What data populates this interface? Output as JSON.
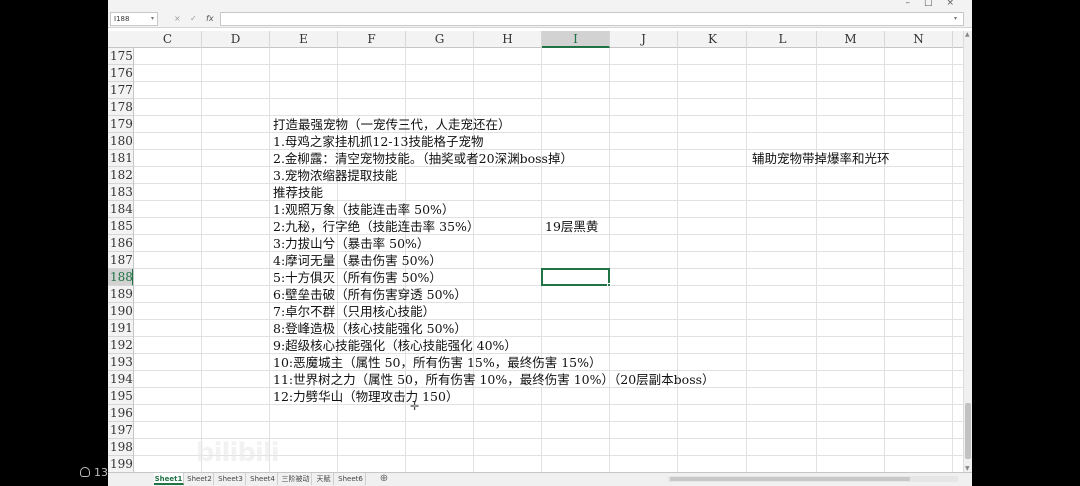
{
  "window": {
    "controls": [
      "–",
      "□",
      "×"
    ]
  },
  "formula_bar": {
    "name_box": "I188",
    "cancel_icon": "×",
    "enter_icon": "✓",
    "fx_label": "fx",
    "value": ""
  },
  "columns": [
    "C",
    "D",
    "E",
    "F",
    "G",
    "H",
    "I",
    "J",
    "K",
    "L",
    "M",
    "N"
  ],
  "selected_column": "I",
  "rows": [
    "175",
    "176",
    "177",
    "178",
    "179",
    "180",
    "181",
    "182",
    "183",
    "184",
    "185",
    "186",
    "187",
    "188",
    "189",
    "190",
    "191",
    "192",
    "193",
    "194",
    "195",
    "196",
    "197",
    "198",
    "199"
  ],
  "selected_row": "188",
  "cells": {
    "E179": "打造最强宠物（一宠传三代，人走宠还在）",
    "E180": "1.母鸡之家挂机抓12-13技能格子宠物",
    "E181": "2.金柳露：清空宠物技能。（抽奖或者20深渊boss掉）",
    "L181": "辅助宠物带掉爆率和光环",
    "E182": "3.宠物浓缩器提取技能",
    "E183": "推荐技能",
    "E184": "1:观照万象（技能连击率 50%）",
    "E185": "2:九秘，行字绝（技能连击率 35%）",
    "I185": "19层黑黄",
    "E186": "3:力拔山兮（暴击率 50%）",
    "E187": "4:摩诃无量（暴击伤害 50%）",
    "E188": "5:十方俱灭（所有伤害 50%）",
    "E189": "6:壁垒击破（所有伤害穿透 50%）",
    "E190": "7:卓尔不群（只用核心技能）",
    "E191": "8:登峰造极（核心技能强化 50%）",
    "E192": "9:超级核心技能强化（核心技能强化 40%）",
    "E193": "10:恶魔城主（属性 50，所有伤害 15%，最终伤害 15%）",
    "E194": "11:世界树之力（属性 50，所有伤害 10%，最终伤害 10%）（20层副本boss）",
    "E195": "12:力劈华山（物理攻击力 150）"
  },
  "sheet_tabs": [
    "Sheet1",
    "Sheet2",
    "Sheet3",
    "Sheet4",
    "三阶被动",
    "天赋",
    "Sheet6"
  ],
  "active_tab": "Sheet1",
  "overlay": {
    "viewer_count": "13",
    "watermark_logo": "bilibili"
  },
  "colors": {
    "accent": "#217346",
    "grid_line": "#e1e1e1",
    "header_bg": "#f3f3f3"
  }
}
